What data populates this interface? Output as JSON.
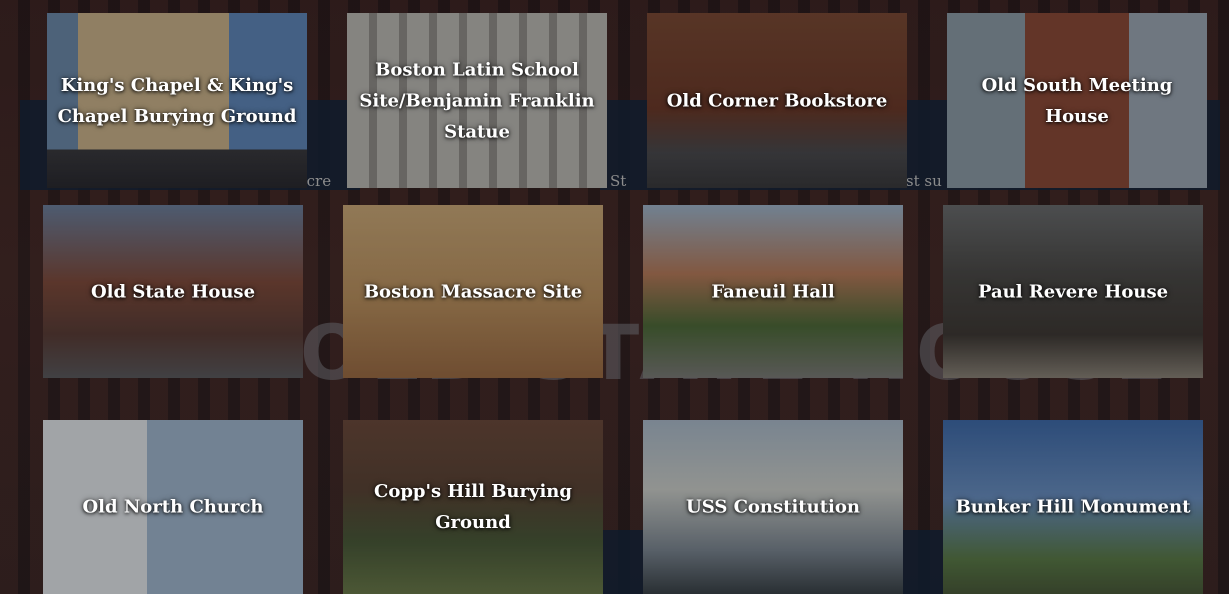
{
  "background": {
    "caption_fragments": [
      "sacre",
      "d St",
      "st su"
    ],
    "heading": "OLD STATE HOUSE",
    "accent_navy": "#0f1b2c"
  },
  "tiles": [
    {
      "label": "King's Chapel & King's Chapel Burying Ground"
    },
    {
      "label": "Boston Latin School Site/Benjamin Franklin Statue"
    },
    {
      "label": "Old Corner Bookstore"
    },
    {
      "label": "Old South Meeting House"
    },
    {
      "label": "Old State House"
    },
    {
      "label": "Boston Massacre Site"
    },
    {
      "label": "Faneuil Hall"
    },
    {
      "label": "Paul Revere House"
    },
    {
      "label": "Old North Church"
    },
    {
      "label": "Copp's Hill Burying Ground"
    },
    {
      "label": "USS Constitution"
    },
    {
      "label": "Bunker Hill Monument"
    }
  ]
}
